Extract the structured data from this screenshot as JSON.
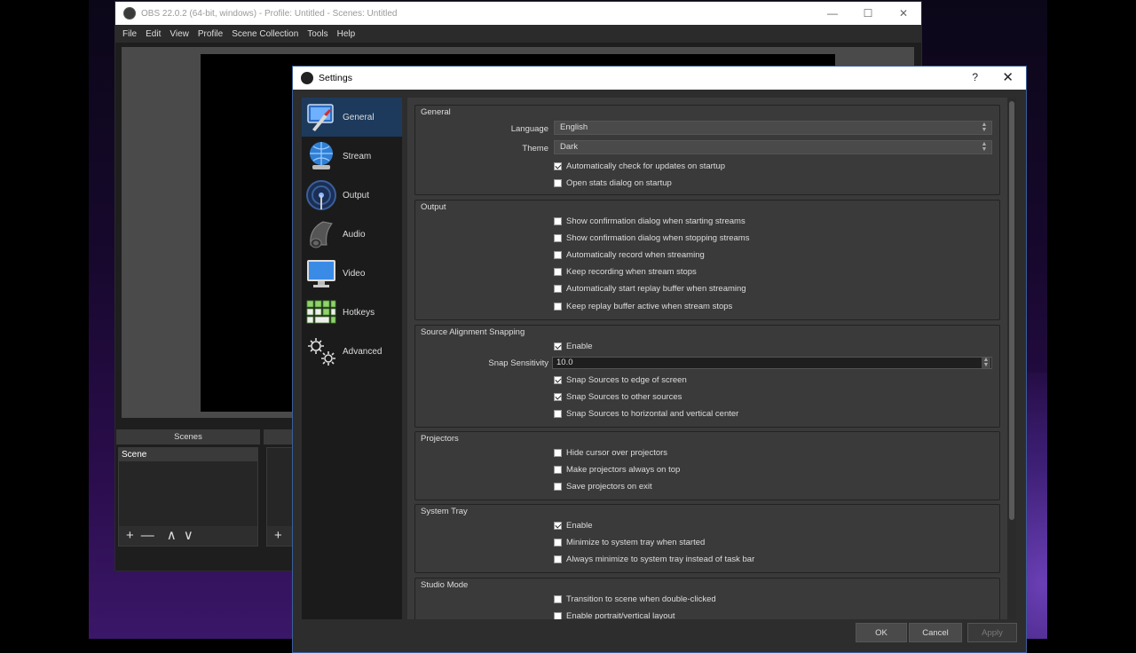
{
  "obs_main": {
    "title": "OBS 22.0.2 (64-bit, windows) - Profile: Untitled - Scenes: Untitled",
    "window_buttons": [
      "—",
      "☐",
      "✕"
    ],
    "menu": [
      "File",
      "Edit",
      "View",
      "Profile",
      "Scene Collection",
      "Tools",
      "Help"
    ],
    "scenes_dock": {
      "header": "Scenes",
      "items": [
        "Scene"
      ],
      "tools": [
        "+",
        "—",
        "∧",
        "∨"
      ]
    },
    "sources_dock": {
      "tools": [
        "+"
      ]
    }
  },
  "settings": {
    "title": "Settings",
    "help_label": "?",
    "close_label": "✕",
    "sidebar": [
      {
        "label": "General",
        "icon": "general-icon",
        "selected": true
      },
      {
        "label": "Stream",
        "icon": "stream-icon",
        "selected": false
      },
      {
        "label": "Output",
        "icon": "output-icon",
        "selected": false
      },
      {
        "label": "Audio",
        "icon": "audio-icon",
        "selected": false
      },
      {
        "label": "Video",
        "icon": "video-icon",
        "selected": false
      },
      {
        "label": "Hotkeys",
        "icon": "hotkeys-icon",
        "selected": false
      },
      {
        "label": "Advanced",
        "icon": "advanced-icon",
        "selected": false
      }
    ],
    "general": {
      "title": "General",
      "language_label": "Language",
      "language_value": "English",
      "theme_label": "Theme",
      "theme_value": "Dark",
      "checks": [
        {
          "label": "Automatically check for updates on startup",
          "checked": true
        },
        {
          "label": "Open stats dialog on startup",
          "checked": false
        }
      ]
    },
    "output": {
      "title": "Output",
      "checks": [
        {
          "label": "Show confirmation dialog when starting streams",
          "checked": false
        },
        {
          "label": "Show confirmation dialog when stopping streams",
          "checked": false
        },
        {
          "label": "Automatically record when streaming",
          "checked": false
        },
        {
          "label": "Keep recording when stream stops",
          "checked": false
        },
        {
          "label": "Automatically start replay buffer when streaming",
          "checked": false
        },
        {
          "label": "Keep replay buffer active when stream stops",
          "checked": false
        }
      ]
    },
    "snapping": {
      "title": "Source Alignment Snapping",
      "enable": {
        "label": "Enable",
        "checked": true
      },
      "sensitivity_label": "Snap Sensitivity",
      "sensitivity_value": "10.0",
      "checks": [
        {
          "label": "Snap Sources to edge of screen",
          "checked": true
        },
        {
          "label": "Snap Sources to other sources",
          "checked": true
        },
        {
          "label": "Snap Sources to horizontal and vertical center",
          "checked": false
        }
      ]
    },
    "projectors": {
      "title": "Projectors",
      "checks": [
        {
          "label": "Hide cursor over projectors",
          "checked": false
        },
        {
          "label": "Make projectors always on top",
          "checked": false
        },
        {
          "label": "Save projectors on exit",
          "checked": false
        }
      ]
    },
    "tray": {
      "title": "System Tray",
      "checks": [
        {
          "label": "Enable",
          "checked": true
        },
        {
          "label": "Minimize to system tray when started",
          "checked": false
        },
        {
          "label": "Always minimize to system tray instead of task bar",
          "checked": false
        }
      ]
    },
    "studio": {
      "title": "Studio Mode",
      "checks": [
        {
          "label": "Transition to scene when double-clicked",
          "checked": false
        },
        {
          "label": "Enable portrait/vertical layout",
          "checked": false
        }
      ]
    },
    "buttons": {
      "ok": "OK",
      "cancel": "Cancel",
      "apply": "Apply"
    }
  }
}
